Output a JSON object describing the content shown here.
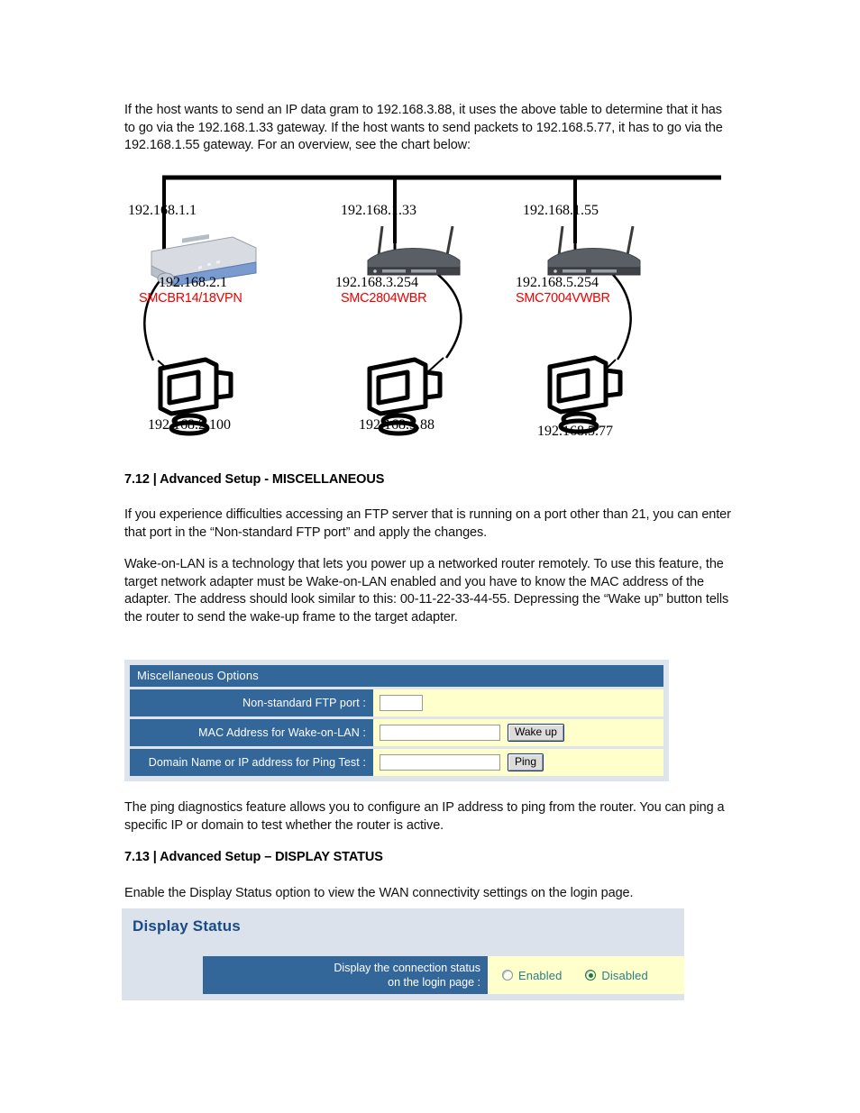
{
  "intro_paragraph": "If the host wants to send an IP data gram to 192.168.3.88, it uses the above table to determine that it has to go via the 192.168.1.33 gateway. If the host wants to send packets to 192.168.5.77, it has to go via the 192.168.1.55 gateway. For an overview, see the chart below:",
  "diagram": {
    "name": "network-topology-diagram",
    "nodes": [
      {
        "wan_ip": "192.168.1.1",
        "lan_ip": "192.168.2.1",
        "model": "SMCBR14/18VPN",
        "client_ip": "192.168.2.100",
        "device_type": "vpn-router"
      },
      {
        "wan_ip": "192.168.1.33",
        "lan_ip": "192.168.3.254",
        "model": "SMC2804WBR",
        "client_ip": "192.168.3.88",
        "device_type": "wireless-router"
      },
      {
        "wan_ip": "192.168.1.55",
        "lan_ip": "192.168.5.254",
        "model": "SMC7004VWBR",
        "client_ip": "192.168.5.77",
        "device_type": "wireless-router"
      }
    ]
  },
  "section_712": {
    "heading": "7.12 | Advanced Setup - MISCELLANEOUS",
    "paragraph_1": "If you experience difficulties accessing an FTP server that is running on a port other than 21, you can enter that port in the “Non-standard FTP port” and apply the changes.",
    "paragraph_2": "Wake-on-LAN is a technology that lets you power up a networked router remotely. To use this feature, the target network adapter must be Wake-on-LAN enabled and you have to know the MAC address of the adapter. The address should look similar to this: 00-11-22-33-44-55. Depressing the “Wake up” button tells the router to send the wake-up frame to the target adapter.",
    "paragraph_3": "The ping diagnostics feature allows you to configure an IP address to ping from the router. You can ping a specific IP or domain to test whether the router is active."
  },
  "misc_panel": {
    "header": "Miscellaneous Options",
    "rows": [
      {
        "label": "Non-standard FTP port :",
        "value": "",
        "button": null
      },
      {
        "label": "MAC Address for Wake-on-LAN :",
        "value": "",
        "button": "Wake up"
      },
      {
        "label": "Domain Name or IP address for Ping Test :",
        "value": "",
        "button": "Ping"
      }
    ],
    "colors": {
      "label_bg": "#336699",
      "field_bg": "#ffffcc",
      "frame_bg": "#dde4ec"
    }
  },
  "section_713": {
    "heading": "7.13 | Advanced Setup – DISPLAY STATUS",
    "paragraph_1": "Enable the Display Status option to view the WAN connectivity settings on the login page."
  },
  "display_status_panel": {
    "title": "Display Status",
    "label_line_1": "Display the connection status",
    "label_line_2": "on the login page :",
    "options": [
      {
        "label": "Enabled",
        "selected": false
      },
      {
        "label": "Disabled",
        "selected": true
      }
    ],
    "colors": {
      "panel_bg": "#dbe2ec",
      "title_color": "#1a4b82",
      "label_bg": "#336699",
      "field_bg": "#ffffcc",
      "radio_label_color": "#2d7f86",
      "radio_selected_color": "#1f7a2e"
    }
  }
}
